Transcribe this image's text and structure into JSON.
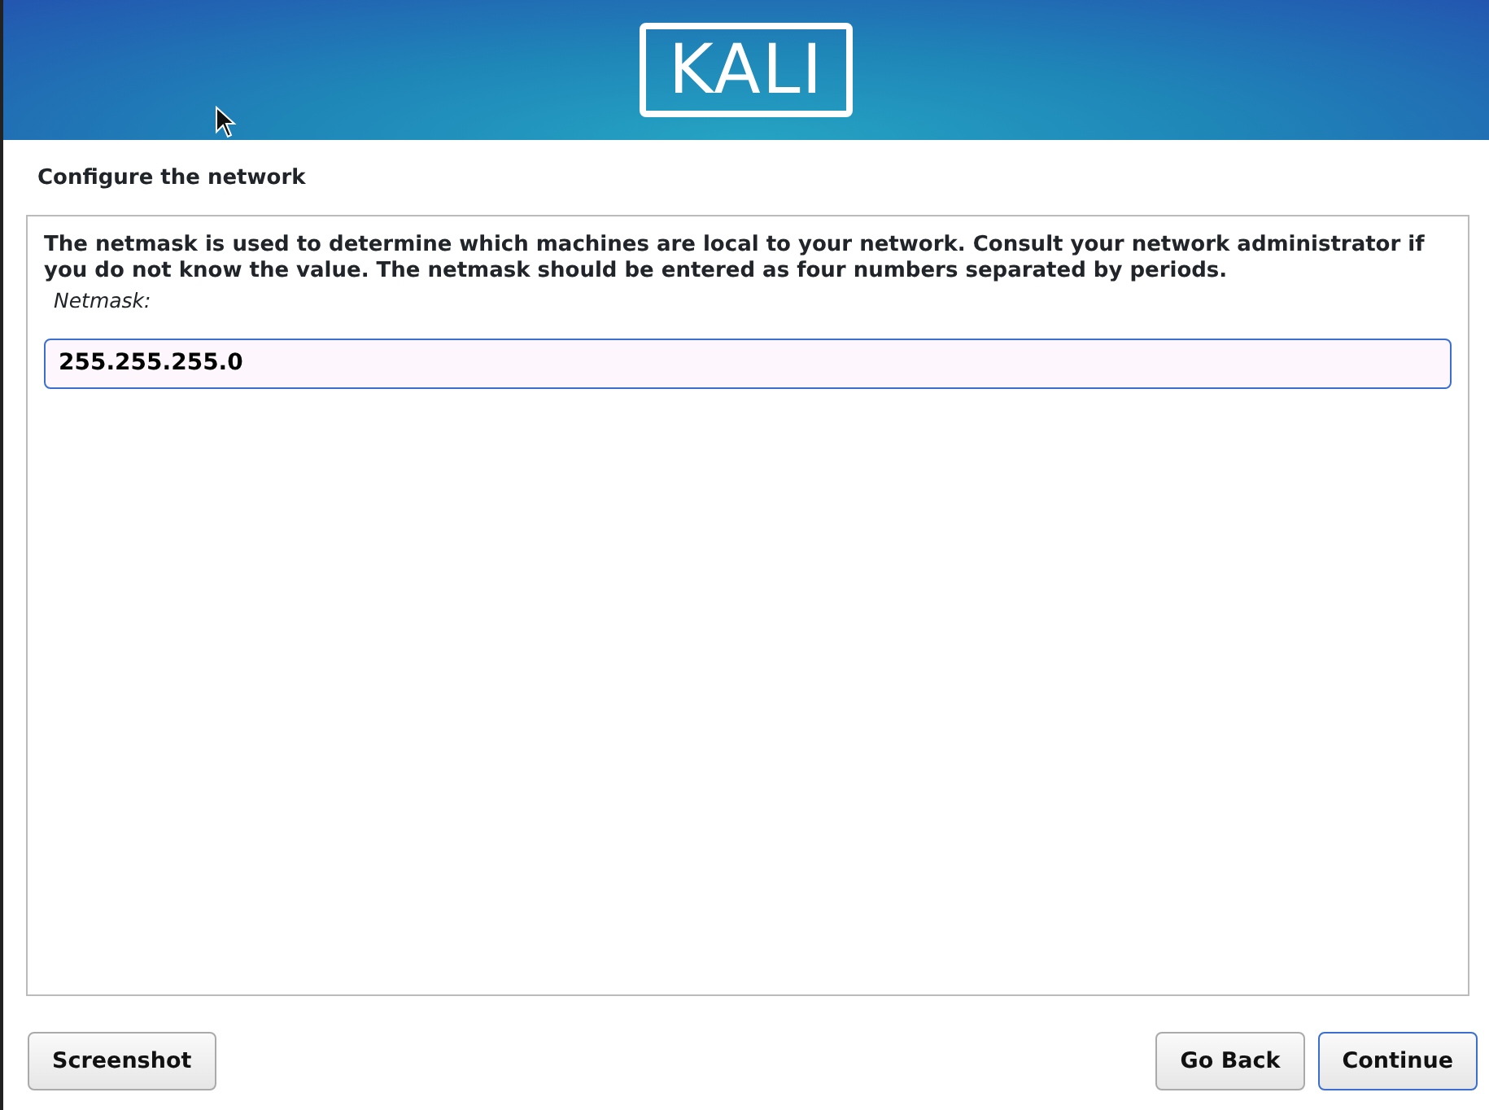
{
  "banner": {
    "logo": "KALI"
  },
  "page_title": "Configure the network",
  "description": "The netmask is used to determine which machines are local to your network.  Consult your network administrator if you do not know the value.  The netmask should be entered as four numbers separated by periods.",
  "field": {
    "label": "Netmask:",
    "value": "255.255.255.0"
  },
  "buttons_left": [
    {
      "label": "Screenshot",
      "focused": false
    }
  ],
  "buttons_right": [
    {
      "label": "Go Back",
      "focused": false
    },
    {
      "label": "Continue",
      "focused": true
    }
  ]
}
